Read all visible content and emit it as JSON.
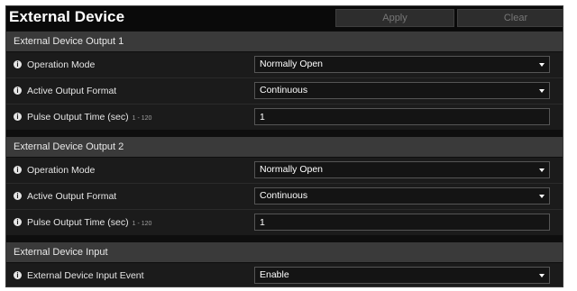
{
  "header": {
    "title": "External Device",
    "apply_label": "Apply",
    "clear_label": "Clear"
  },
  "sections": [
    {
      "title": "External Device Output 1",
      "rows": [
        {
          "label": "Operation Mode",
          "value": "Normally Open"
        },
        {
          "label": "Active Output Format",
          "value": "Continuous"
        },
        {
          "label": "Pulse Output Time (sec)",
          "hint": "1 - 120",
          "value": "1"
        }
      ]
    },
    {
      "title": "External Device Output 2",
      "rows": [
        {
          "label": "Operation Mode",
          "value": "Normally Open"
        },
        {
          "label": "Active Output Format",
          "value": "Continuous"
        },
        {
          "label": "Pulse Output Time (sec)",
          "hint": "1 - 120",
          "value": "1"
        }
      ]
    },
    {
      "title": "External Device Input",
      "rows": [
        {
          "label": "External Device Input Event",
          "value": "Enable"
        }
      ]
    }
  ],
  "icons": {
    "info": "info-icon",
    "dropdown": "chevron-down-icon"
  },
  "colors": {
    "background": "#0e0e0e",
    "section_header": "#3a3a3a",
    "row": "#1b1b1b",
    "text": "#e6e6e6"
  }
}
